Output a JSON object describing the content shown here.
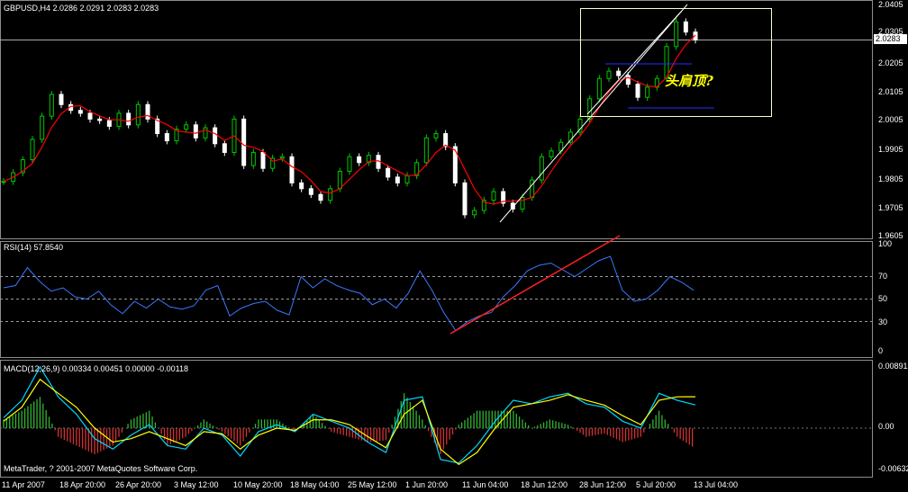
{
  "window": {
    "symbol_header": "GBPUSD,H4  2.0286 2.0291 2.0283 2.0283",
    "copyright": "MetaTrader, ? 2001-2007 MetaQuotes Software Corp."
  },
  "price_pane": {
    "axis_ticks": [
      "2.0405",
      "2.0305",
      "2.0205",
      "2.0105",
      "2.0005",
      "1.9905",
      "1.9805",
      "1.9705",
      "1.9605"
    ],
    "current_price": "2.0283",
    "annotation": "头肩顶?",
    "ylim": [
      1.9605,
      2.0405
    ]
  },
  "rsi_pane": {
    "label": "RSI(14) 57.8540",
    "axis_ticks": [
      "100",
      "70",
      "50",
      "30",
      "0"
    ],
    "levels": [
      70,
      50,
      30
    ],
    "ylim": [
      0,
      100
    ]
  },
  "macd_pane": {
    "label": "MACD(12,26,9) 0.00334 0.00451 0.00000 -0.00118",
    "axis_ticks": [
      "0.00891",
      "0.00",
      "-0.00632"
    ],
    "ylim": [
      -0.00632,
      0.00891
    ]
  },
  "time_axis": [
    "11 Apr 2007",
    "18 Apr 20:00",
    "26 Apr 20:00",
    "3 May 12:00",
    "10 May 20:00",
    "18 May 04:00",
    "25 May 12:00",
    "1 Jun 20:00",
    "11 Jun 04:00",
    "18 Jun 12:00",
    "28 Jun 12:00",
    "5 Jul 20:00",
    "13 Jul 04:00"
  ],
  "colors": {
    "background": "#000000",
    "bull_candle": "#00c800",
    "bear_candle": "#ffffff",
    "moving_average": "#ff0000",
    "rsi_line": "#3c78ff",
    "macd_main": "#00d8ff",
    "macd_signal": "#ffff00",
    "trendline": "#ffffff",
    "annotation": "#ffff00"
  },
  "chart_data": [
    {
      "type": "candlestick",
      "title": "GBPUSD,H4",
      "series": [
        {
          "name": "GBPUSD",
          "closes": [
            1.9795,
            1.9825,
            1.987,
            1.994,
            2.002,
            2.0095,
            2.006,
            2.004,
            2.003,
            2.001,
            2.0005,
            1.9985,
            2.003,
            1.999,
            2.006,
            2.001,
            1.996,
            1.9935,
            1.9975,
            1.999,
            1.9945,
            1.998,
            1.9925,
            1.9895,
            2.001,
            1.985,
            1.9895,
            1.984,
            1.9875,
            1.988,
            1.979,
            1.977,
            1.975,
            1.973,
            1.977,
            1.983,
            1.988,
            1.986,
            1.9885,
            1.984,
            1.981,
            1.979,
            1.9815,
            1.986,
            1.9945,
            1.996,
            1.9915,
            1.979,
            1.968,
            1.9695,
            1.973,
            1.976,
            1.972,
            1.97,
            1.974,
            1.98,
            1.988,
            1.99,
            1.993,
            1.9965,
            2.001,
            2.008,
            2.015,
            2.0175,
            2.016,
            2.013,
            2.0085,
            2.012,
            2.015,
            2.026,
            2.0345,
            2.031,
            2.0283
          ]
        }
      ]
    },
    {
      "type": "line",
      "title": "RSI(14) 57.8540",
      "series": [
        {
          "name": "RSI(14)",
          "values": [
            60,
            62,
            78,
            66,
            57,
            60,
            52,
            50,
            57,
            45,
            37,
            48,
            42,
            50,
            43,
            41,
            44,
            58,
            62,
            35,
            42,
            46,
            48,
            40,
            36,
            70,
            60,
            68,
            62,
            58,
            55,
            45,
            50,
            42,
            55,
            75,
            58,
            38,
            22,
            30,
            35,
            38,
            52,
            62,
            75,
            80,
            82,
            76,
            70,
            77,
            84,
            88,
            58,
            48,
            50,
            58,
            70,
            65,
            57.854
          ]
        }
      ]
    },
    {
      "type": "line",
      "title": "MACD(12,26,9) 0.00334 0.00451 0.00000 -0.00118",
      "series": [
        {
          "name": "MACD main",
          "values": [
            0.0015,
            0.004,
            0.0088,
            0.0045,
            0.002,
            -0.0015,
            -0.003,
            -0.001,
            0.0005,
            -0.0025,
            -0.003,
            0.0,
            -0.001,
            -0.004,
            -0.0005,
            0.0005,
            -0.0005,
            0.002,
            0.001,
            0.0,
            -0.002,
            -0.0035,
            0.004,
            0.0045,
            -0.0045,
            -0.005,
            -0.0025,
            0.001,
            0.004,
            0.0035,
            0.0045,
            0.005,
            0.0035,
            0.003,
            0.001,
            0.0,
            0.005,
            0.004,
            0.00334
          ]
        },
        {
          "name": "MACD signal",
          "values": [
            0.001,
            0.003,
            0.007,
            0.005,
            0.003,
            0.0,
            -0.002,
            -0.0015,
            -0.0005,
            -0.0015,
            -0.0025,
            -0.0005,
            -0.0008,
            -0.003,
            -0.001,
            0.0,
            -0.0003,
            0.0012,
            0.0012,
            0.0005,
            -0.0012,
            -0.0028,
            0.002,
            0.004,
            -0.003,
            -0.0052,
            -0.0035,
            0.0,
            0.003,
            0.0035,
            0.004,
            0.0048,
            0.004,
            0.0033,
            0.0018,
            0.0005,
            0.004,
            0.0045,
            0.00451
          ]
        }
      ]
    }
  ]
}
